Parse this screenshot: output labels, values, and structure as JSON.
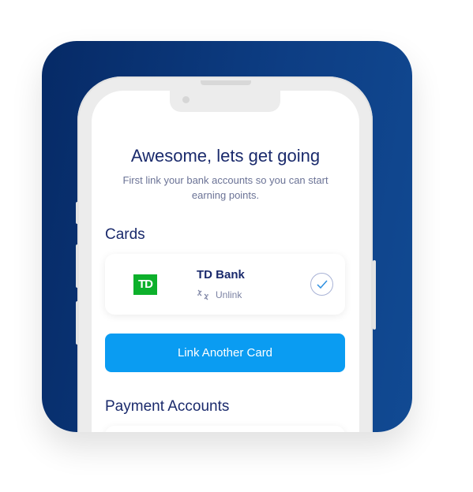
{
  "header": {
    "title": "Awesome, lets get going",
    "subtitle": "First link your bank accounts so you can start earning points."
  },
  "cards": {
    "heading": "Cards",
    "items": [
      {
        "logo_text": "TD",
        "name": "TD Bank",
        "action": "Unlink",
        "linked": true
      }
    ],
    "link_button": "Link Another Card"
  },
  "payment_accounts": {
    "heading": "Payment Accounts"
  },
  "colors": {
    "accent": "#0a9cf2",
    "navy": "#1a2a6c",
    "td_green": "#0db02b"
  }
}
